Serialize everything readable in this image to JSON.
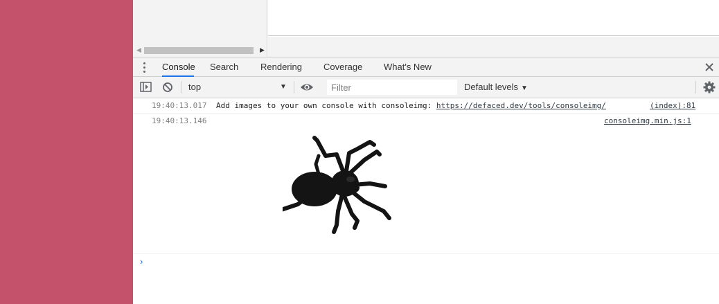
{
  "drawer": {
    "tabs": [
      {
        "label": "Console",
        "active": true
      },
      {
        "label": "Search",
        "active": false
      },
      {
        "label": "Rendering",
        "active": false
      },
      {
        "label": "Coverage",
        "active": false
      },
      {
        "label": "What's New",
        "active": false
      }
    ]
  },
  "toolbar": {
    "context": "top",
    "filter_placeholder": "Filter",
    "levels": "Default levels"
  },
  "console": {
    "messages": [
      {
        "timestamp": "19:40:13.017",
        "text": "Add images to your own console with consoleimg: ",
        "link": "https://defaced.dev/tools/consoleimg/",
        "source": "(index):81"
      },
      {
        "timestamp": "19:40:13.146",
        "image": "spider-image",
        "source": "consoleimg.min.js:1"
      }
    ],
    "prompt": "›"
  },
  "icons": {
    "menu": "kebab-menu-icon",
    "close": "close-icon",
    "sidebar": "show-sidebar-icon",
    "clear": "clear-console-icon",
    "eye": "live-expression-eye-icon",
    "settings": "gear-icon"
  },
  "colors": {
    "page_background": "#c4526a",
    "accent": "#1a73e8",
    "toolbar": "#f3f3f3"
  }
}
